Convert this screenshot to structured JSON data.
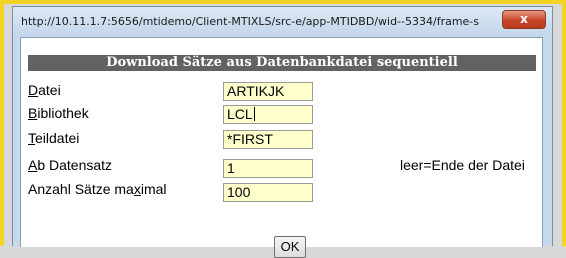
{
  "window": {
    "title": "http://10.11.1.7:5656/mtidemo/Client-MTIXLS/src-e/app-MTIDBD/wid--5334/frame-s",
    "close_label": "x"
  },
  "form": {
    "heading": "Download Sätze aus Datenbankdatei sequentiell",
    "fields": [
      {
        "label_accel": "D",
        "label_rest": "atei",
        "value": "ARTIKJK"
      },
      {
        "label_accel": "B",
        "label_rest": "ibliothek",
        "value": "LCL"
      },
      {
        "label_accel": "T",
        "label_rest": "eildatei",
        "value": "*FIRST"
      },
      {
        "label_accel": "A",
        "label_rest": "b Datensatz",
        "value": "1",
        "hint": "leer=Ende der Datei"
      },
      {
        "label_before": "Anzahl Sätze ma",
        "label_accel": "x",
        "label_after": "imal",
        "value": "100"
      }
    ],
    "ok_label": "OK"
  },
  "colors": {
    "frame_highlight": "#f3d324",
    "input_background": "#ffffcc",
    "header_background": "#626262",
    "close_button": "#c8472b"
  }
}
